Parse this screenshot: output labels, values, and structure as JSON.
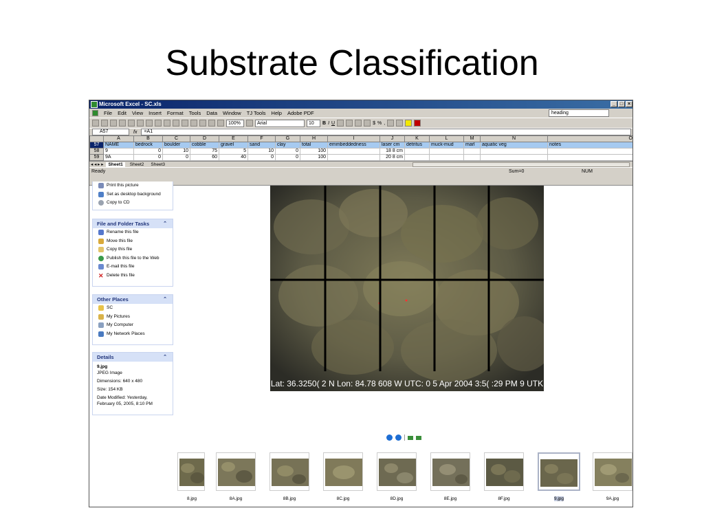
{
  "slide": {
    "title": "Substrate Classification"
  },
  "excel": {
    "window_title": "Microsoft Excel - SC.xls",
    "menu": [
      "File",
      "Edit",
      "View",
      "Insert",
      "Format",
      "Tools",
      "Data",
      "Window",
      "TJ Tools",
      "Help",
      "Adobe PDF"
    ],
    "help_box": "heading",
    "toolbar": {
      "zoom": "100%",
      "font": "Arial",
      "font_size": "10"
    },
    "name_box": "A57",
    "formula": "=A1",
    "columns": [
      "A",
      "B",
      "C",
      "D",
      "E",
      "F",
      "G",
      "H",
      "I",
      "J",
      "K",
      "L",
      "M",
      "N",
      "O"
    ],
    "rows": [
      {
        "num": "57",
        "cells": [
          "NAME",
          "bedrock",
          "boulder",
          "cobble",
          "gravel",
          "sand",
          "clay",
          "total",
          "emmbeddedness",
          "laser  cm",
          "detritus",
          "muck-mud",
          "marl",
          "aquatic  veg",
          "notes"
        ]
      },
      {
        "num": "58",
        "cells": [
          "9",
          "0",
          "10",
          "75",
          "5",
          "10",
          "0",
          "100",
          "",
          "18 8 cm",
          "",
          "",
          "",
          "",
          ""
        ]
      },
      {
        "num": "59",
        "cells": [
          "9A",
          "0",
          "0",
          "60",
          "40",
          "0",
          "0",
          "100",
          "",
          "20 8 cm",
          "",
          "",
          "",
          "",
          ""
        ]
      }
    ],
    "sheet_tabs": [
      "Sheet1",
      "Sheet2",
      "Sheet3"
    ],
    "status_left": "Ready",
    "status_sum": "Sum=0",
    "status_num": "NUM"
  },
  "explorer": {
    "picture_tasks": [
      "Print this picture",
      "Set as desktop background",
      "Copy to CD"
    ],
    "file_folder_tasks": {
      "title": "File and Folder Tasks",
      "items": [
        "Rename this file",
        "Move this file",
        "Copy this file",
        "Publish this file to the Web",
        "E-mail this file",
        "Delete this file"
      ]
    },
    "other_places": {
      "title": "Other Places",
      "items": [
        "SC",
        "My Pictures",
        "My Computer",
        "My Network Places"
      ]
    },
    "details": {
      "title": "Details",
      "filename": "9.jpg",
      "type": "JPEG Image",
      "dimensions": "Dimensions: 640 x 480",
      "size": "Size: 154 KB",
      "modified": "Date Modified: Yesterday, February 05, 2005, 8:10 PM"
    }
  },
  "photo": {
    "caption": "Lat: 36.3250( 2 N Lon: 84.78  608 W UTC: 0 5 Apr 2004 3:5( :29 PM 9 UTK"
  },
  "thumbnails": [
    {
      "label": "8.jpg",
      "selected": false
    },
    {
      "label": "8A.jpg",
      "selected": false
    },
    {
      "label": "8B.jpg",
      "selected": false
    },
    {
      "label": "8C.jpg",
      "selected": false
    },
    {
      "label": "8D.jpg",
      "selected": false
    },
    {
      "label": "8E.jpg",
      "selected": false
    },
    {
      "label": "8F.jpg",
      "selected": false
    },
    {
      "label": "9.jpg",
      "selected": true
    },
    {
      "label": "9A.jpg",
      "selected": false
    }
  ],
  "colors": {
    "title_bar": "#0a246a",
    "task_header": "#d6e1f7",
    "selected_row": "#a6caf0"
  },
  "icons": {
    "nav_prev": "previous-image-icon",
    "nav_next": "next-image-icon",
    "rotate": "rotate-icon"
  }
}
